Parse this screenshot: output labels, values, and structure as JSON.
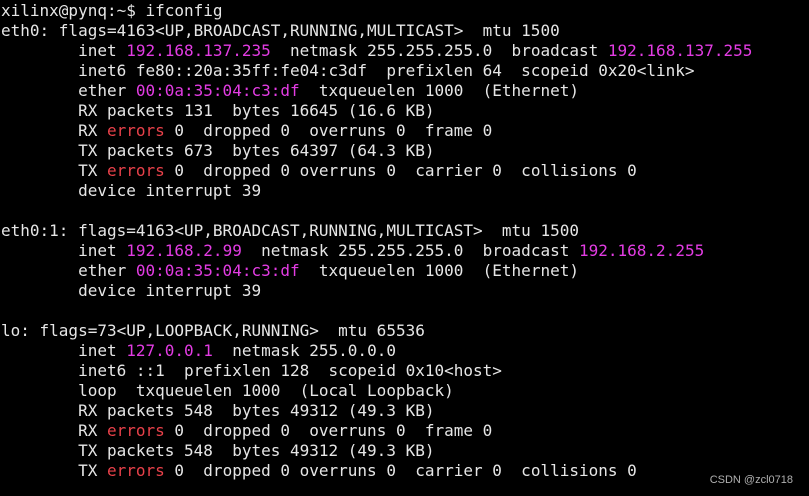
{
  "colors": {
    "background": "#000000",
    "text": "#e6e6e6",
    "address": "#e33ce3",
    "error": "#e8414a"
  },
  "terminal": {
    "lines": [
      [
        {
          "t": "xilinx@pynq:~$ ifconfig"
        }
      ],
      [
        {
          "t": "eth0: flags=4163<UP,BROADCAST,RUNNING,MULTICAST>  mtu 1500"
        }
      ],
      [
        {
          "t": "        inet "
        },
        {
          "t": "192.168.137.235",
          "c": "p"
        },
        {
          "t": "  netmask 255.255.255.0  broadcast "
        },
        {
          "t": "192.168.137.255",
          "c": "p"
        }
      ],
      [
        {
          "t": "        inet6 fe80::20a:35ff:fe04:c3df  prefixlen 64  scopeid 0x20<link>"
        }
      ],
      [
        {
          "t": "        ether "
        },
        {
          "t": "00:0a:35:04:c3:df",
          "c": "p"
        },
        {
          "t": "  txqueuelen 1000  (Ethernet)"
        }
      ],
      [
        {
          "t": "        RX packets 131  bytes 16645 (16.6 KB)"
        }
      ],
      [
        {
          "t": "        RX "
        },
        {
          "t": "errors",
          "c": "r"
        },
        {
          "t": " 0  dropped 0  overruns 0  frame 0"
        }
      ],
      [
        {
          "t": "        TX packets 673  bytes 64397 (64.3 KB)"
        }
      ],
      [
        {
          "t": "        TX "
        },
        {
          "t": "errors",
          "c": "r"
        },
        {
          "t": " 0  dropped 0 overruns 0  carrier 0  collisions 0"
        }
      ],
      [
        {
          "t": "        device interrupt 39"
        }
      ],
      [
        {
          "t": ""
        }
      ],
      [
        {
          "t": "eth0:1: flags=4163<UP,BROADCAST,RUNNING,MULTICAST>  mtu 1500"
        }
      ],
      [
        {
          "t": "        inet "
        },
        {
          "t": "192.168.2.99",
          "c": "p"
        },
        {
          "t": "  netmask 255.255.255.0  broadcast "
        },
        {
          "t": "192.168.2.255",
          "c": "p"
        }
      ],
      [
        {
          "t": "        ether "
        },
        {
          "t": "00:0a:35:04:c3:df",
          "c": "p"
        },
        {
          "t": "  txqueuelen 1000  (Ethernet)"
        }
      ],
      [
        {
          "t": "        device interrupt 39"
        }
      ],
      [
        {
          "t": ""
        }
      ],
      [
        {
          "t": "lo: flags=73<UP,LOOPBACK,RUNNING>  mtu 65536"
        }
      ],
      [
        {
          "t": "        inet "
        },
        {
          "t": "127.0.0.1",
          "c": "p"
        },
        {
          "t": "  netmask 255.0.0.0"
        }
      ],
      [
        {
          "t": "        inet6 ::1  prefixlen 128  scopeid 0x10<host>"
        }
      ],
      [
        {
          "t": "        loop  txqueuelen 1000  (Local Loopback)"
        }
      ],
      [
        {
          "t": "        RX packets 548  bytes 49312 (49.3 KB)"
        }
      ],
      [
        {
          "t": "        RX "
        },
        {
          "t": "errors",
          "c": "r"
        },
        {
          "t": " 0  dropped 0  overruns 0  frame 0"
        }
      ],
      [
        {
          "t": "        TX packets 548  bytes 49312 (49.3 KB)"
        }
      ],
      [
        {
          "t": "        TX "
        },
        {
          "t": "errors",
          "c": "r"
        },
        {
          "t": " 0  dropped 0 overruns 0  carrier 0  collisions 0"
        }
      ]
    ]
  },
  "watermark": "CSDN @zcl0718"
}
